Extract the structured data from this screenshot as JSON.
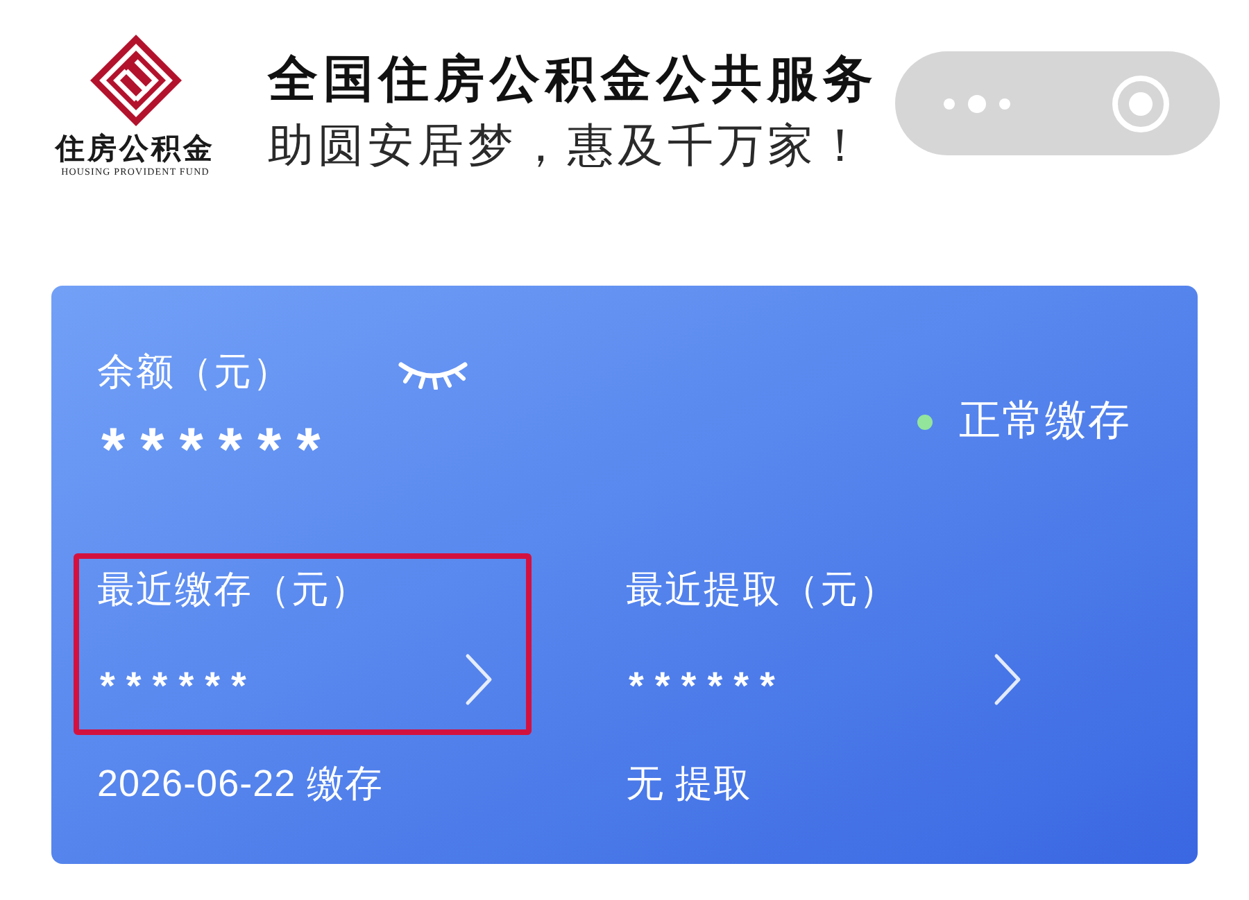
{
  "header": {
    "logo": {
      "name": "住房公积金",
      "english": "HOUSING PROVIDENT FUND"
    },
    "title": "全国住房公积金公共服务",
    "slogan": "助圆安居梦，惠及千万家！"
  },
  "card": {
    "balance": {
      "label": "余额（元）",
      "value": "******",
      "masked": true
    },
    "status": {
      "label": "正常缴存"
    },
    "items": [
      {
        "label": "最近缴存（元）",
        "value": "******",
        "note": "2026-06-22 缴存",
        "highlighted": true
      },
      {
        "label": "最近提取（元）",
        "value": "******",
        "note": "无 提取",
        "highlighted": false
      }
    ]
  }
}
